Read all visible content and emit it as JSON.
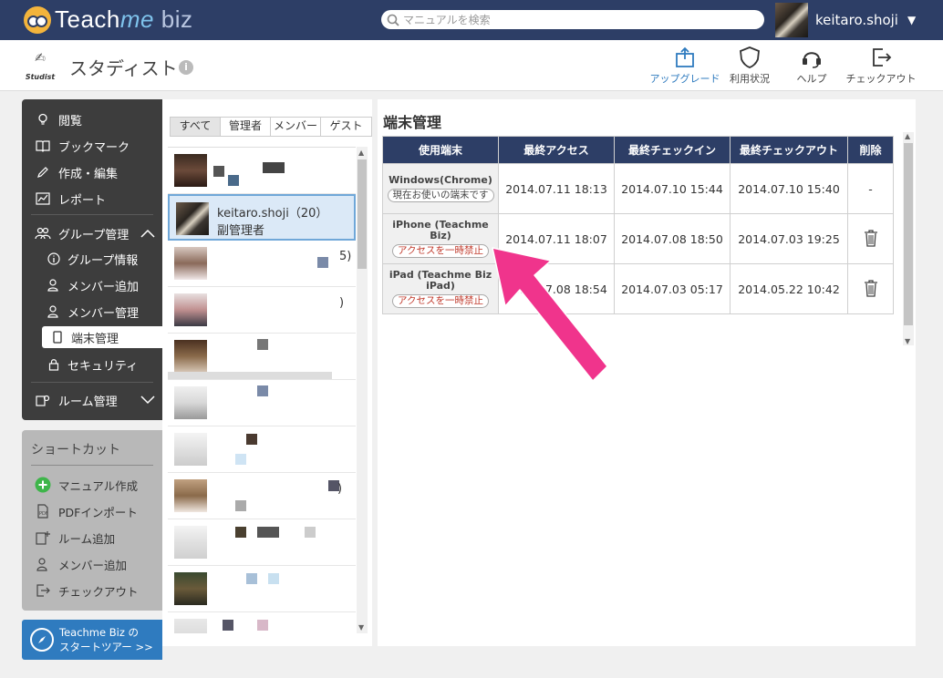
{
  "app": {
    "logo_main": "Teach",
    "logo_me": "me",
    "logo_biz": " biz",
    "search_placeholder": "マニュアルを検索",
    "user_name": "keitaro.shoji"
  },
  "header": {
    "brand_word": "Studist",
    "org_name": "スタディスト",
    "buttons": [
      {
        "label": "アップグレード",
        "icon": "upgrade-icon",
        "color": "#2f7bbf"
      },
      {
        "label": "利用状況",
        "icon": "shield-icon"
      },
      {
        "label": "ヘルプ",
        "icon": "headset-icon"
      },
      {
        "label": "チェックアウト",
        "icon": "checkout-icon"
      }
    ]
  },
  "sidebar": {
    "items": [
      {
        "label": "閲覧",
        "icon": "lightbulb-icon"
      },
      {
        "label": "ブックマーク",
        "icon": "book-icon"
      },
      {
        "label": "作成・編集",
        "icon": "pen-icon"
      },
      {
        "label": "レポート",
        "icon": "chart-icon"
      },
      {
        "label": "グループ管理",
        "icon": "group-icon",
        "expanded": true
      },
      {
        "label": "グループ情報",
        "icon": "info-icon"
      },
      {
        "label": "メンバー追加",
        "icon": "add-member-icon"
      },
      {
        "label": "メンバー管理",
        "icon": "members-icon"
      },
      {
        "label": "端末管理",
        "icon": "device-icon",
        "active": true
      },
      {
        "label": "セキュリティ",
        "icon": "lock-icon"
      },
      {
        "label": "ルーム管理",
        "icon": "room-icon",
        "expanded": false
      }
    ]
  },
  "shortcut": {
    "title": "ショートカット",
    "items": [
      {
        "label": "マニュアル作成",
        "icon": "plus-circle-icon"
      },
      {
        "label": "PDFインポート",
        "icon": "pdf-icon"
      },
      {
        "label": "ルーム追加",
        "icon": "add-room-icon"
      },
      {
        "label": "メンバー追加",
        "icon": "add-member-icon"
      },
      {
        "label": "チェックアウト",
        "icon": "checkout-icon"
      }
    ]
  },
  "tour": {
    "line1": "Teachme Biz の",
    "line2": "スタートツアー >>"
  },
  "members": {
    "tabs": [
      "すべて",
      "管理者",
      "メンバー",
      "ゲスト"
    ],
    "active_tab": "すべて",
    "selected": {
      "name": "keitaro.shoji（20）",
      "role": "副管理者"
    },
    "partial_texts": [
      "5)",
      ")",
      ")"
    ]
  },
  "device_table": {
    "title": "端末管理",
    "headers": [
      "使用端末",
      "最終アクセス",
      "最終チェックイン",
      "最終チェックアウト",
      "削除"
    ],
    "rows": [
      {
        "device": "Windows(Chrome)",
        "badge": "現在お使いの端末です",
        "last_access": "2014.07.11 18:13",
        "last_checkin": "2014.07.10 15:44",
        "last_checkout": "2014.07.10 15:40",
        "delete": "-"
      },
      {
        "device": "iPhone (Teachme Biz)",
        "badge": "アクセスを一時禁止",
        "last_access": "2014.07.11 18:07",
        "last_checkin": "2014.07.08 18:50",
        "last_checkout": "2014.07.03 19:25",
        "delete": "trash-icon"
      },
      {
        "device": "iPad (Teachme Biz iPad)",
        "badge": "アクセスを一時禁止",
        "last_access": "2014.07.08 18:54",
        "last_checkin": "2014.07.03 05:17",
        "last_checkout": "2014.05.22 10:42",
        "delete": "trash-icon"
      }
    ]
  },
  "colors": {
    "topbar": "#2d3e66",
    "accent": "#2f7bbf",
    "arrow": "#f0348c",
    "sidebar": "#3d3d3d"
  }
}
